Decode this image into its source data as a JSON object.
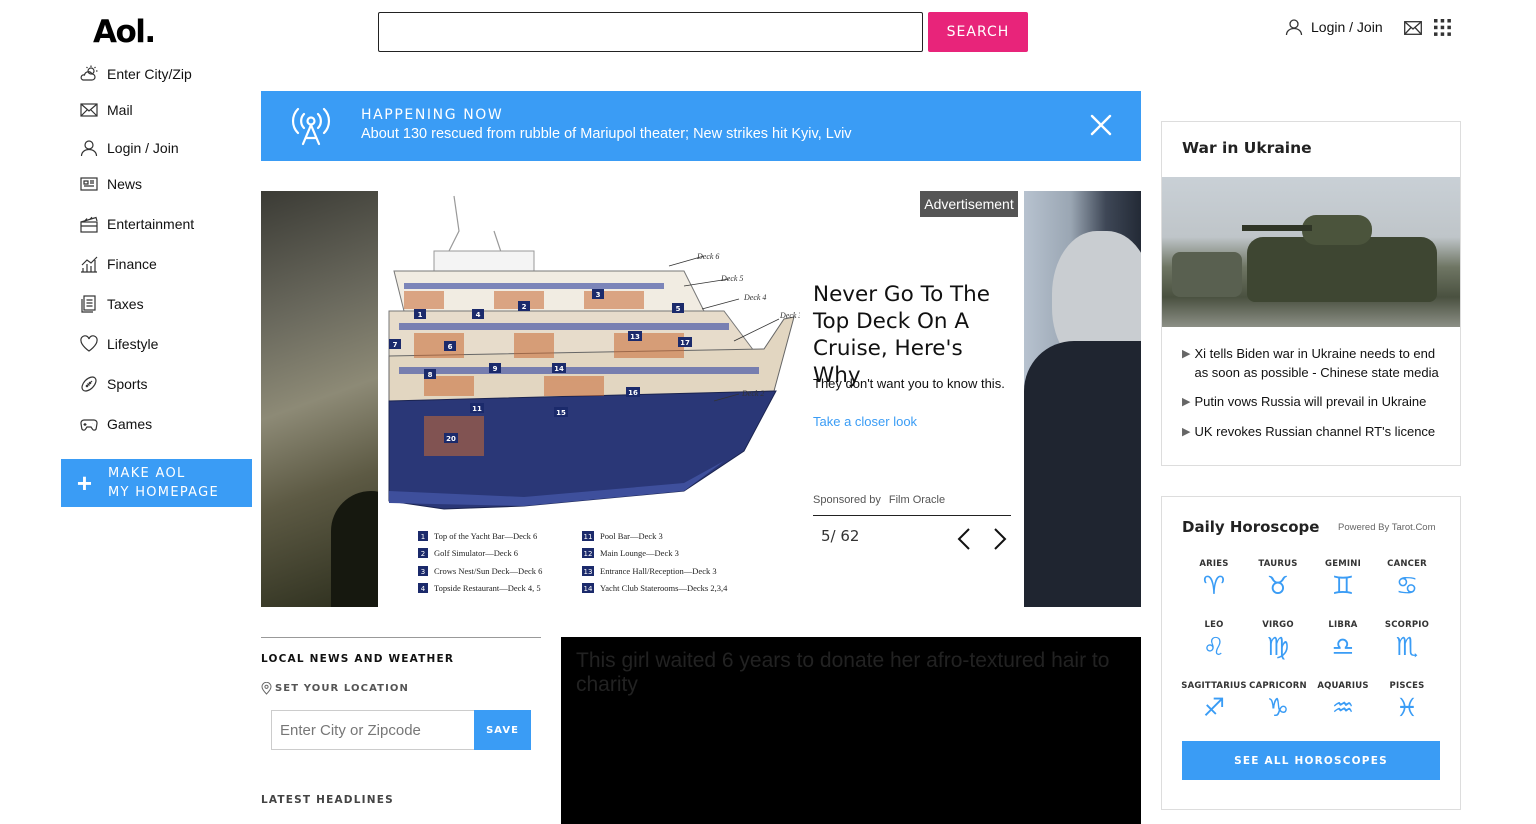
{
  "header": {
    "logo": "Aol.",
    "search": {
      "value": "",
      "placeholder": "",
      "button_label": "SEARCH"
    },
    "login_label": "Login / Join"
  },
  "sidebar": {
    "items": [
      {
        "label": "Enter City/Zip",
        "icon": "weather-icon"
      },
      {
        "label": "Mail",
        "icon": "mail-icon"
      },
      {
        "label": "Login / Join",
        "icon": "user-icon"
      },
      {
        "label": "News",
        "icon": "news-icon"
      },
      {
        "label": "Entertainment",
        "icon": "entertainment-icon"
      },
      {
        "label": "Finance",
        "icon": "finance-icon"
      },
      {
        "label": "Taxes",
        "icon": "taxes-icon"
      },
      {
        "label": "Lifestyle",
        "icon": "heart-icon"
      },
      {
        "label": "Sports",
        "icon": "football-icon"
      },
      {
        "label": "Games",
        "icon": "gamepad-icon"
      }
    ],
    "make_homepage": {
      "line1": "MAKE AOL",
      "line2": "MY HOMEPAGE"
    }
  },
  "happening_now": {
    "label": "HAPPENING NOW",
    "headline": "About 130 rescued from rubble of Mariupol theater; New strikes hit Kyiv, Lviv"
  },
  "carousel": {
    "ad_badge": "Advertisement",
    "title": "Never Go To The Top Deck On A Cruise, Here's Why",
    "description": "They don't want you to know this.",
    "link": "Take a closer look",
    "sponsored_by_label": "Sponsored by",
    "sponsor": "Film Oracle",
    "counter": "5/ 62",
    "diagram": {
      "decks": [
        "Deck 6",
        "Deck 5",
        "Deck 4",
        "Deck 3",
        "Deck 2"
      ],
      "numbers": [
        "1",
        "2",
        "3",
        "4",
        "5",
        "6",
        "7",
        "8",
        "9",
        "11",
        "13",
        "14",
        "15",
        "16",
        "17",
        "20"
      ],
      "legend_left": [
        {
          "n": "1",
          "text": "Top of the Yacht Bar—Deck 6"
        },
        {
          "n": "2",
          "text": "Golf Simulator—Deck 6"
        },
        {
          "n": "3",
          "text": "Crows Nest/Sun Deck—Deck 6"
        },
        {
          "n": "4",
          "text": "Topside Restaurant—Deck 4, 5"
        }
      ],
      "legend_right": [
        {
          "n": "11",
          "text": "Pool Bar—Deck 3"
        },
        {
          "n": "12",
          "text": "Main Lounge—Deck 3"
        },
        {
          "n": "13",
          "text": "Entrance Hall/Reception—Deck 3"
        },
        {
          "n": "14",
          "text": "Yacht Club Staterooms—Decks 2,3,4"
        }
      ]
    }
  },
  "local_news": {
    "title": "LOCAL NEWS AND WEATHER",
    "set_location": "SET YOUR LOCATION",
    "input_placeholder": "Enter City or Zipcode",
    "save_label": "SAVE",
    "latest_headlines": "LATEST HEADLINES"
  },
  "video": {
    "title": "This girl waited 6 years to donate her afro-textured hair to charity"
  },
  "war_in_ukraine": {
    "title": "War in Ukraine",
    "items": [
      "Xi tells Biden war in Ukraine needs to end as soon as possible - Chinese state media",
      "Putin vows Russia will prevail in Ukraine",
      "UK revokes Russian channel RT's licence"
    ]
  },
  "horoscope": {
    "title": "Daily Horoscope",
    "powered_by": "Powered By Tarot.Com",
    "signs": [
      {
        "name": "ARIES",
        "glyph": "♈"
      },
      {
        "name": "TAURUS",
        "glyph": "♉"
      },
      {
        "name": "GEMINI",
        "glyph": "♊"
      },
      {
        "name": "CANCER",
        "glyph": "♋"
      },
      {
        "name": "LEO",
        "glyph": "♌"
      },
      {
        "name": "VIRGO",
        "glyph": "♍"
      },
      {
        "name": "LIBRA",
        "glyph": "♎"
      },
      {
        "name": "SCORPIO",
        "glyph": "♏"
      },
      {
        "name": "SAGITTARIUS",
        "glyph": "♐"
      },
      {
        "name": "CAPRICORN",
        "glyph": "♑"
      },
      {
        "name": "AQUARIUS",
        "glyph": "♒"
      },
      {
        "name": "PISCES",
        "glyph": "♓"
      }
    ],
    "see_all": "SEE ALL HOROSCOPES"
  },
  "colors": {
    "accent_blue": "#3a9cf5",
    "search_pink": "#e8247a"
  }
}
